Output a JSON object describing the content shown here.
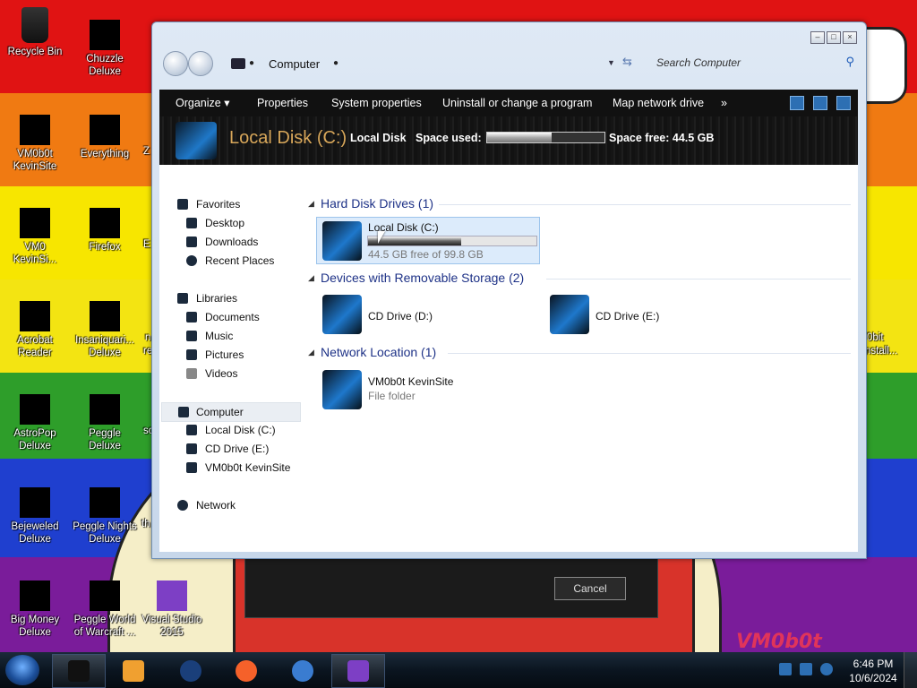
{
  "desktop": {
    "icons": [
      {
        "label": "Recycle Bin"
      },
      {
        "label": "Chuzzle Deluxe"
      },
      {
        "label": "VM0b0t KevinSite"
      },
      {
        "label": "Everything"
      },
      {
        "label": "VM0 KevinSi..."
      },
      {
        "label": "Firefox"
      },
      {
        "label": "Acrobat Reader"
      },
      {
        "label": "Insaniquari... Deluxe"
      },
      {
        "label": "AstroPop Deluxe"
      },
      {
        "label": "Peggle Deluxe"
      },
      {
        "label": "Bejeweled Deluxe"
      },
      {
        "label": "Peggle Nights Deluxe"
      },
      {
        "label": "Big Money Deluxe"
      },
      {
        "label": "Peggle World of Warcraft ..."
      },
      {
        "label": "Visual Studio 2015"
      }
    ],
    "partial_labels": [
      "Z",
      "E",
      "n",
      "re",
      "sc",
      "th",
      "0bit",
      "nstall..."
    ],
    "watermark": "VM0b0t",
    "dialog": {
      "cancel_label": "Cancel"
    }
  },
  "window": {
    "address": {
      "location": "Computer"
    },
    "search": {
      "placeholder": "Search Computer"
    },
    "toolbar": {
      "items": [
        "Organize ▾",
        "Properties",
        "System properties",
        "Uninstall or change a program",
        "Map network drive",
        "»"
      ]
    },
    "header": {
      "title": "Local Disk (C:)",
      "subtitle": "Local Disk",
      "space_used_label": "Space used:",
      "space_used_fraction": 0.553,
      "space_free": "Space free: 44.5 GB"
    },
    "nav": {
      "favorites": "Favorites",
      "desktop": "Desktop",
      "downloads": "Downloads",
      "recent": "Recent Places",
      "libraries": "Libraries",
      "documents": "Documents",
      "music": "Music",
      "pictures": "Pictures",
      "videos": "Videos",
      "computer": "Computer",
      "local_disk": "Local Disk (C:)",
      "cd_drive": "CD Drive (E:)",
      "vm": "VM0b0t KevinSite",
      "network": "Network"
    },
    "groups": {
      "hdd": "Hard Disk Drives (1)",
      "removable": "Devices with Removable Storage (2)",
      "netloc": "Network Location (1)"
    },
    "items": {
      "local_disk": {
        "name": "Local Disk (C:)",
        "free": "44.5 GB free of 99.8 GB",
        "used_fraction": 0.553
      },
      "cd_d": {
        "name": "CD Drive (D:)"
      },
      "cd_e": {
        "name": "CD Drive (E:)"
      },
      "vm": {
        "name": "VM0b0t KevinSite",
        "type": "File folder"
      }
    }
  },
  "taskbar": {
    "time": "6:46 PM",
    "date": "10/6/2024"
  },
  "colors": {
    "accent": "#1e3287",
    "header_title": "#d8a75a"
  }
}
